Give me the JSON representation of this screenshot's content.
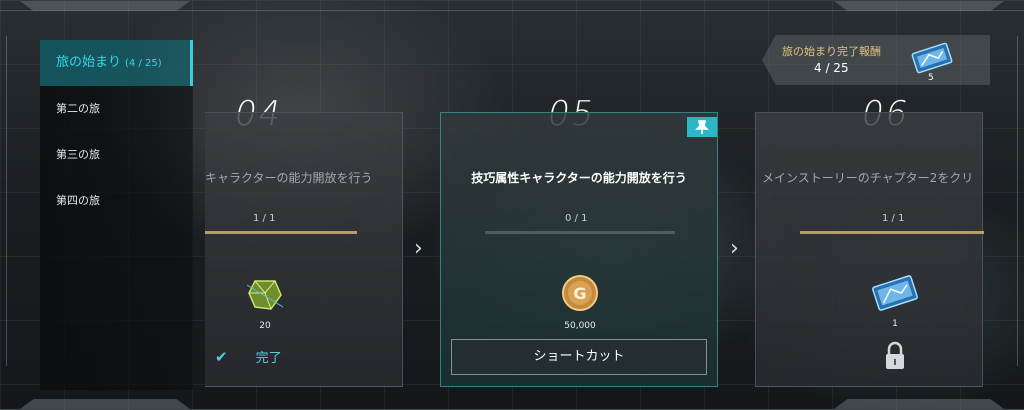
{
  "sidebar": {
    "items": [
      {
        "label": "旅の始まり",
        "count": "(4 / 25)"
      },
      {
        "label": "第二の旅"
      },
      {
        "label": "第三の旅"
      },
      {
        "label": "第四の旅"
      }
    ]
  },
  "milestone": {
    "title": "旅の始まり完了報酬",
    "progress": "4 / 25",
    "reward_qty": "5"
  },
  "cards": [
    {
      "number": "04",
      "mission": "キャラクターの能力開放を行う",
      "progress": "1 / 1",
      "progress_fraction": 1.0,
      "reward_icon": "gem-crystal-icon",
      "reward_qty": "20",
      "status": "完了"
    },
    {
      "number": "05",
      "mission": "技巧属性キャラクターの能力開放を行う",
      "progress": "0 / 1",
      "progress_fraction": 0.0,
      "reward_icon": "gold-coin-icon",
      "reward_qty": "50,000",
      "action": "ショートカット"
    },
    {
      "number": "06",
      "mission": "メインストーリーのチャプター2をクリ",
      "progress": "1 / 1",
      "progress_fraction": 1.0,
      "reward_icon": "ticket-card-icon",
      "reward_qty": "1"
    }
  ],
  "colors": {
    "accent": "#36d0dd",
    "gold": "#b59e6a",
    "reward_title": "#e2c47b"
  }
}
